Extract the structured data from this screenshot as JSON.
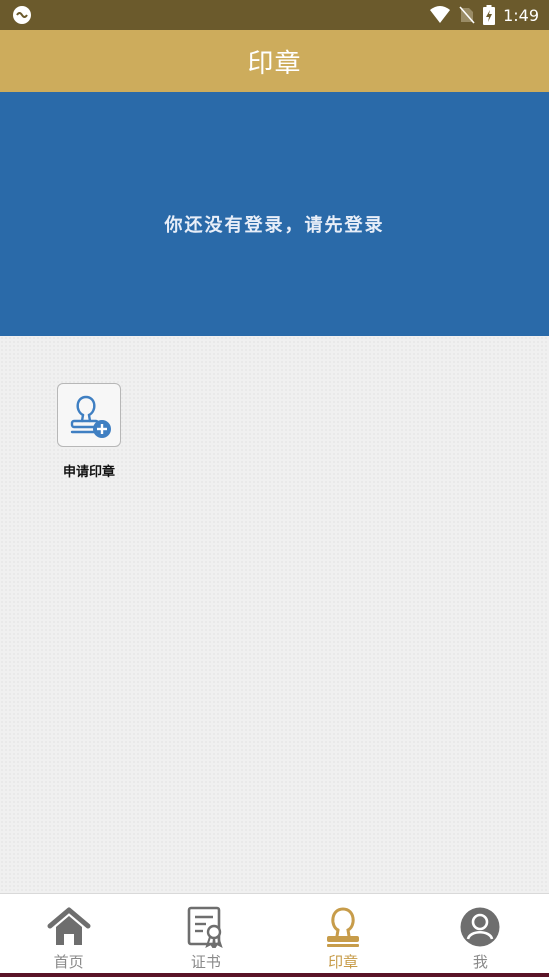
{
  "status_bar": {
    "time": "1:49",
    "icons": [
      "app-badge-icon",
      "wifi-icon",
      "no-sim-icon",
      "battery-charging-icon"
    ]
  },
  "header": {
    "title": "印章"
  },
  "banner": {
    "message": "你还没有登录，请先登录"
  },
  "actions": [
    {
      "label": "申请印章",
      "icon": "seal-add-icon"
    }
  ],
  "tabs": [
    {
      "label": "首页",
      "icon": "home-icon",
      "active": false
    },
    {
      "label": "证书",
      "icon": "certificate-icon",
      "active": false
    },
    {
      "label": "印章",
      "icon": "seal-icon",
      "active": true
    },
    {
      "label": "我",
      "icon": "user-icon",
      "active": false
    }
  ],
  "colors": {
    "status_bar": "#6b5a2c",
    "header": "#cdac5c",
    "banner": "#2a6aa9",
    "active_tab": "#c79c4a",
    "inactive_tab": "#8a8a8a"
  }
}
